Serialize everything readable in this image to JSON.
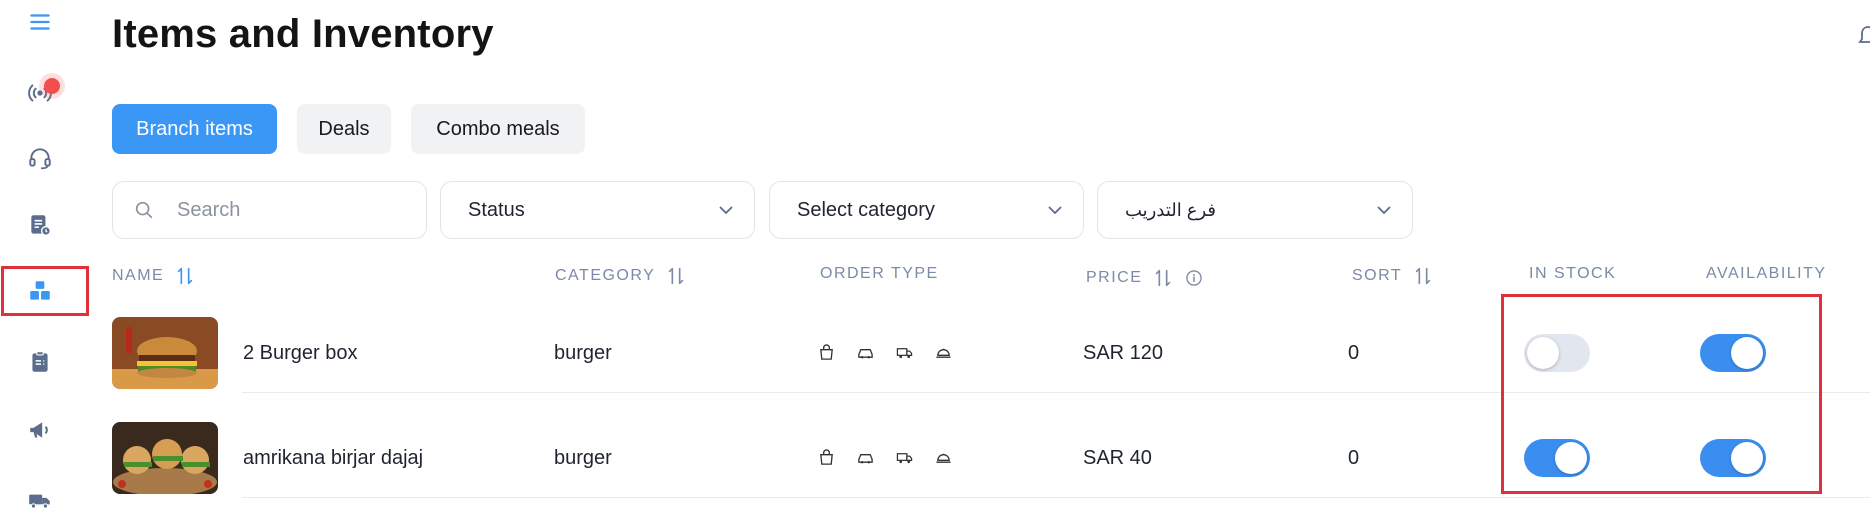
{
  "page": {
    "title": "Items and Inventory"
  },
  "sidebar": {
    "items": [
      {
        "icon": "menu-icon"
      },
      {
        "icon": "live-broadcast-icon"
      },
      {
        "icon": "headset-icon"
      },
      {
        "icon": "orders-icon"
      },
      {
        "icon": "inventory-boxes-icon"
      },
      {
        "icon": "clipboard-icon"
      },
      {
        "icon": "megaphone-icon"
      },
      {
        "icon": "delivery-truck-icon"
      }
    ]
  },
  "tabs": [
    {
      "label": "Branch items",
      "active": true
    },
    {
      "label": "Deals",
      "active": false
    },
    {
      "label": "Combo meals",
      "active": false
    }
  ],
  "filters": {
    "search_placeholder": "Search",
    "status": "Status",
    "category": "Select category",
    "branch": "فرع التدريب"
  },
  "table": {
    "headers": {
      "name": "NAME",
      "category": "CATEGORY",
      "order_type": "ORDER TYPE",
      "price": "PRICE",
      "sort": "SORT",
      "in_stock": "IN STOCK",
      "availability": "AVAILABILITY"
    },
    "rows": [
      {
        "name": "2 Burger box",
        "category": "burger",
        "price": "SAR 120",
        "sort": "0",
        "in_stock": false,
        "availability": true
      },
      {
        "name": "amrikana birjar dajaj",
        "category": "burger",
        "price": "SAR 40",
        "sort": "0",
        "in_stock": true,
        "availability": true
      }
    ],
    "order_type_icons": [
      "bag-icon",
      "car-icon",
      "delivery-truck-icon",
      "dine-in-cloche-icon"
    ]
  },
  "colors": {
    "accent": "#3a97f6",
    "toggle_on": "#3a8ef0",
    "toggle_off": "#e1e6ef",
    "annotation": "#e0303a",
    "header_text": "#7b8aa6"
  }
}
